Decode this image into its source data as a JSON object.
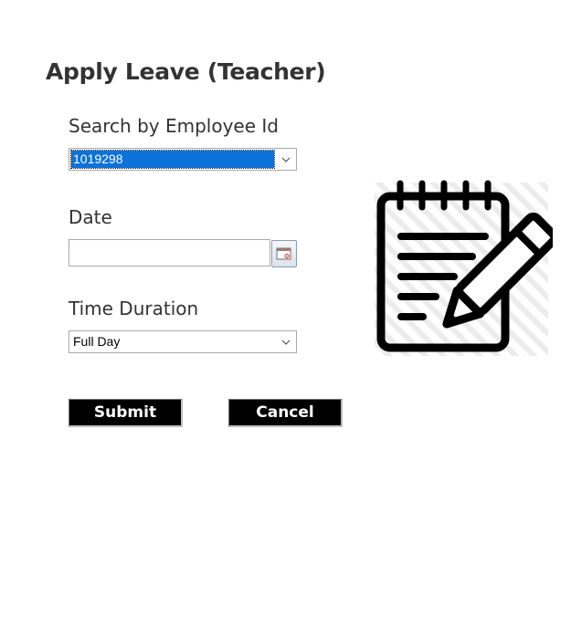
{
  "page": {
    "title": "Apply Leave (Teacher)"
  },
  "form": {
    "employee_search": {
      "label": "Search by Employee Id",
      "selected": "1019298"
    },
    "date": {
      "label": "Date",
      "value": ""
    },
    "duration": {
      "label": "Time Duration",
      "selected": "Full Day"
    }
  },
  "actions": {
    "submit_label": "Submit",
    "cancel_label": "Cancel"
  },
  "icons": {
    "calendar_button": "calendar-icon",
    "dropdown": "chevron-down-icon",
    "illustration": "notepad-pencil-icon"
  },
  "colors": {
    "selection_highlight": "#0a72d8",
    "button_background": "#000000",
    "button_text": "#ffffff",
    "title_text": "#333333"
  }
}
